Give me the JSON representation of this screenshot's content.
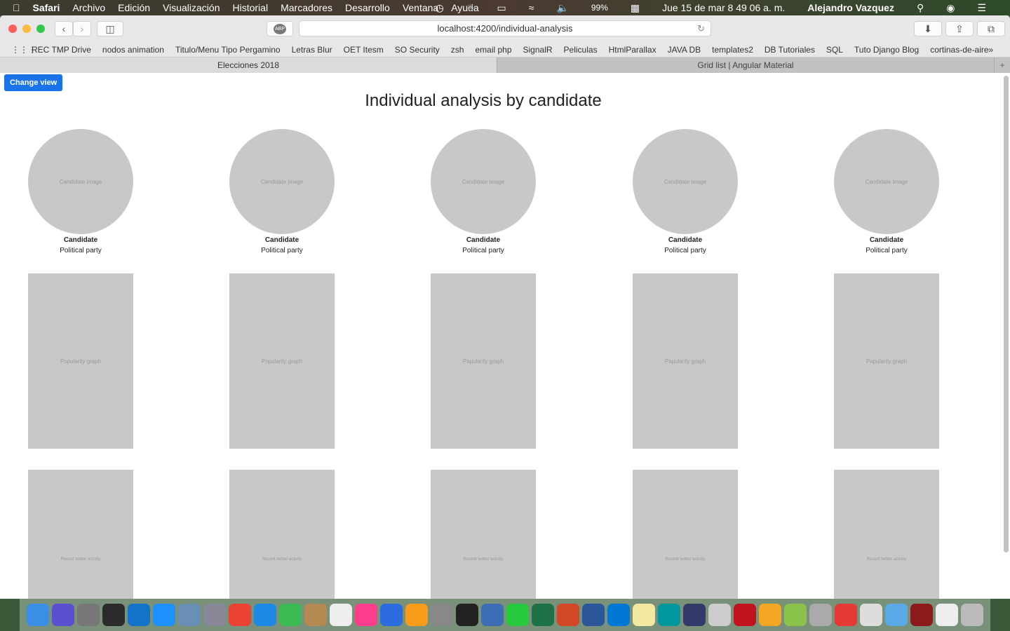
{
  "menubar": {
    "app": "Safari",
    "items": [
      "Archivo",
      "Edición",
      "Visualización",
      "Historial",
      "Marcadores",
      "Desarrollo",
      "Ventana",
      "Ayuda"
    ],
    "battery": "99%",
    "datetime": "Jue 15 de mar  8 49 06 a. m.",
    "user": "Alejandro Vazquez"
  },
  "browser": {
    "url": "localhost:4200/individual-analysis",
    "abp": "ABP",
    "bookmarks": [
      "REC TMP Drive",
      "nodos animation",
      "Titulo/Menu Tipo Pergamino",
      "Letras Blur",
      "OET Itesm",
      "SO Security",
      "zsh",
      "email php",
      "SignalR",
      "Peliculas",
      "HtmlParallax",
      "JAVA DB",
      "templates2",
      "DB Tutoriales",
      "SQL",
      "Tuto Django Blog",
      "cortinas-de-aire"
    ],
    "tabs": [
      "Elecciones 2018",
      "Grid list | Angular Material"
    ]
  },
  "page": {
    "change_view": "Change view",
    "title": "Individual analysis by candidate",
    "candidates": [
      {
        "image": "Candidate image",
        "name": "Candidate",
        "party": "Political party",
        "graph": "Popularity graph",
        "twitter": "Recent twitter activity"
      },
      {
        "image": "Candidate image",
        "name": "Candidate",
        "party": "Political party",
        "graph": "Popularity graph",
        "twitter": "Recent twitter activity"
      },
      {
        "image": "Candidate image",
        "name": "Candidate",
        "party": "Political party",
        "graph": "Popularity graph",
        "twitter": "Recent twitter activity"
      },
      {
        "image": "Candidate image",
        "name": "Candidate",
        "party": "Political party",
        "graph": "Popularity graph",
        "twitter": "Recent twitter activity"
      },
      {
        "image": "Candidate image",
        "name": "Candidate",
        "party": "Political party",
        "graph": "Popularity graph",
        "twitter": "Recent twitter activity"
      }
    ]
  },
  "dock_colors": [
    "#3a8ee6",
    "#5a4fcf",
    "#777",
    "#2b2b2b",
    "#1273c9",
    "#1e90ff",
    "#6a8fb5",
    "#889",
    "#ea4335",
    "#1e88e5",
    "#3cba54",
    "#b58a52",
    "#eee",
    "#fc3c8d",
    "#2d6cdf",
    "#f89c1c",
    "#888",
    "#222",
    "#3d6eb5",
    "#27c93f",
    "#1e7145",
    "#d24726",
    "#2b579a",
    "#0078d4",
    "#f2e8a0",
    "#00979d",
    "#333a6a",
    "#ccc",
    "#c1121f",
    "#f5a623",
    "#8bc34a",
    "#aaa",
    "#e53935",
    "#ddd",
    "#5aa9e6",
    "#8b1a1a",
    "#eee",
    "#bbb"
  ]
}
